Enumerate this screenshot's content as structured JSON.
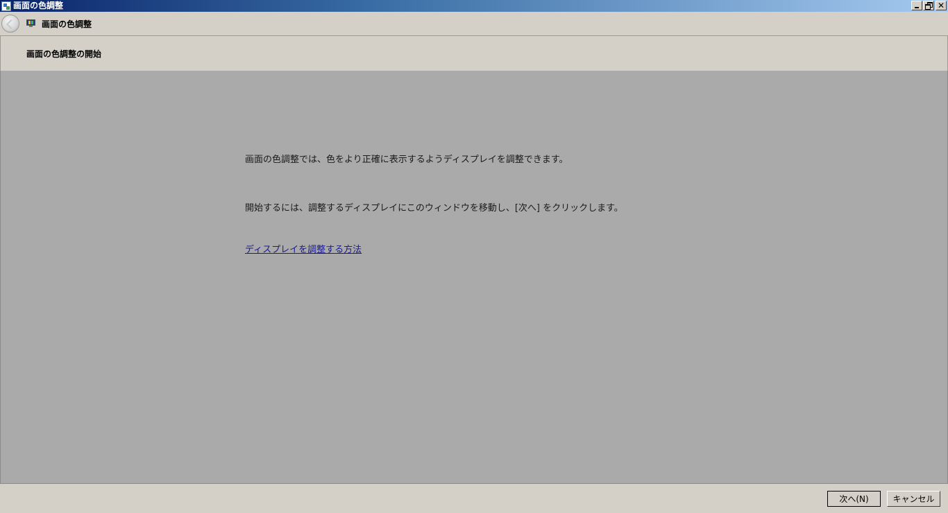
{
  "window": {
    "title": "画面の色調整"
  },
  "titlebar": {
    "app_icon": "display-calibration-icon",
    "minimize_icon": "minimize-icon",
    "restore_icon": "restore-icon",
    "close_icon": "close-icon",
    "close_glyph": "✕"
  },
  "nav": {
    "back_icon": "back-arrow-icon",
    "page_icon": "monitor-icon",
    "title": "画面の色調整"
  },
  "header": {
    "heading": "画面の色調整の開始"
  },
  "content": {
    "paragraph1": "画面の色調整では、色をより正確に表示するようディスプレイを調整できます。",
    "paragraph2": "開始するには、調整するディスプレイにこのウィンドウを移動し、[次へ] をクリックします。",
    "help_link": "ディスプレイを調整する方法",
    "background_color": "#aaaaaa"
  },
  "footer": {
    "next_label": "次へ(N)",
    "cancel_label": "キャンセル"
  }
}
